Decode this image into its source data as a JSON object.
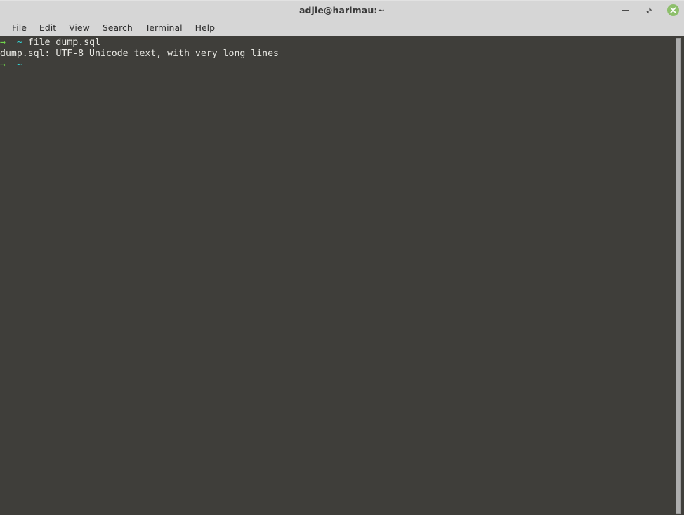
{
  "window": {
    "title": "adjie@harimau:~",
    "controls": {
      "minimize_label": "Minimize",
      "maximize_label": "Restore",
      "close_label": "Close"
    }
  },
  "menubar": {
    "items": [
      {
        "label": "File"
      },
      {
        "label": "Edit"
      },
      {
        "label": "View"
      },
      {
        "label": "Search"
      },
      {
        "label": "Terminal"
      },
      {
        "label": "Help"
      }
    ]
  },
  "terminal": {
    "background_color": "#3f3e3a",
    "foreground_color": "#e8e8e3",
    "prompt_arrow_color": "#70d44b",
    "prompt_path_color": "#34d9d9",
    "prompt_arrow": "→",
    "prompt_path": "~",
    "lines": [
      {
        "type": "command",
        "prompt_arrow": "→",
        "prompt_path": "~",
        "text": " file dump.sql"
      },
      {
        "type": "output",
        "text": "dump.sql: UTF-8 Unicode text, with very long lines"
      },
      {
        "type": "prompt",
        "prompt_arrow": "→",
        "prompt_path": "~",
        "text": ""
      }
    ]
  },
  "scrollbar": {
    "orientation": "vertical",
    "thumb_color": "#aeaeae"
  }
}
